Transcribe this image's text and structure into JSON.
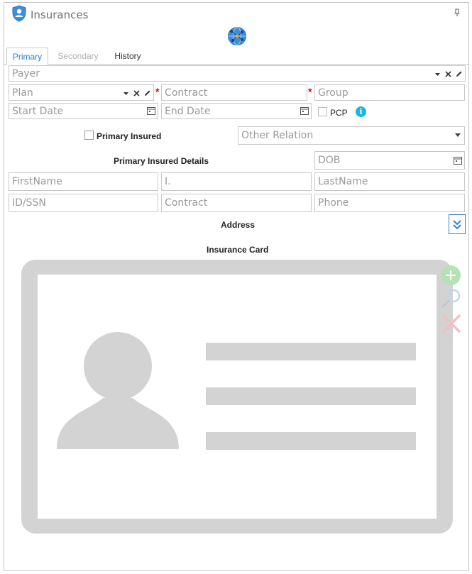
{
  "header": {
    "title": "Insurances"
  },
  "tabs": [
    {
      "label": "Primary"
    },
    {
      "label": "Secondary"
    },
    {
      "label": "History"
    }
  ],
  "form": {
    "payer": {
      "placeholder": "Payer"
    },
    "plan": {
      "placeholder": "Plan"
    },
    "contract": {
      "placeholder": "Contract"
    },
    "group": {
      "placeholder": "Group"
    },
    "start_date": {
      "placeholder": "Start Date"
    },
    "end_date": {
      "placeholder": "End Date"
    },
    "pcp_label": "PCP",
    "primary_insured_label": "Primary Insured",
    "other_relation": {
      "placeholder": "Other Relation"
    },
    "required_mark": "*"
  },
  "insured_details": {
    "heading": "Primary Insured Details",
    "dob": {
      "placeholder": "DOB"
    },
    "first_name": {
      "placeholder": "FirstName"
    },
    "middle_initial": {
      "placeholder": "I."
    },
    "last_name": {
      "placeholder": "LastName"
    },
    "id_ssn": {
      "placeholder": "ID/SSN"
    },
    "contract": {
      "placeholder": "Contract"
    },
    "phone": {
      "placeholder": "Phone"
    }
  },
  "address": {
    "heading": "Address"
  },
  "insurance_card": {
    "heading": "Insurance Card"
  },
  "info_glyph": "i",
  "colors": {
    "accent_blue": "#2b7bd1",
    "info_blue": "#1ab4e8",
    "required_red": "#dd0000",
    "card_gray": "#d3d3d3",
    "add_green": "#b6e0b6",
    "delete_red": "#f2c0c0"
  },
  "icons": {
    "app": "shield-user-icon",
    "pin": "pin-icon",
    "globe": "globe-network-icon",
    "dropdown": "chevron-down-icon",
    "clear": "close-icon",
    "edit": "pencil-icon",
    "calendar": "calendar-icon",
    "info": "info-icon",
    "expand": "double-chevron-down-icon",
    "add": "add-icon",
    "zoom": "magnifier-icon",
    "delete": "delete-icon"
  }
}
